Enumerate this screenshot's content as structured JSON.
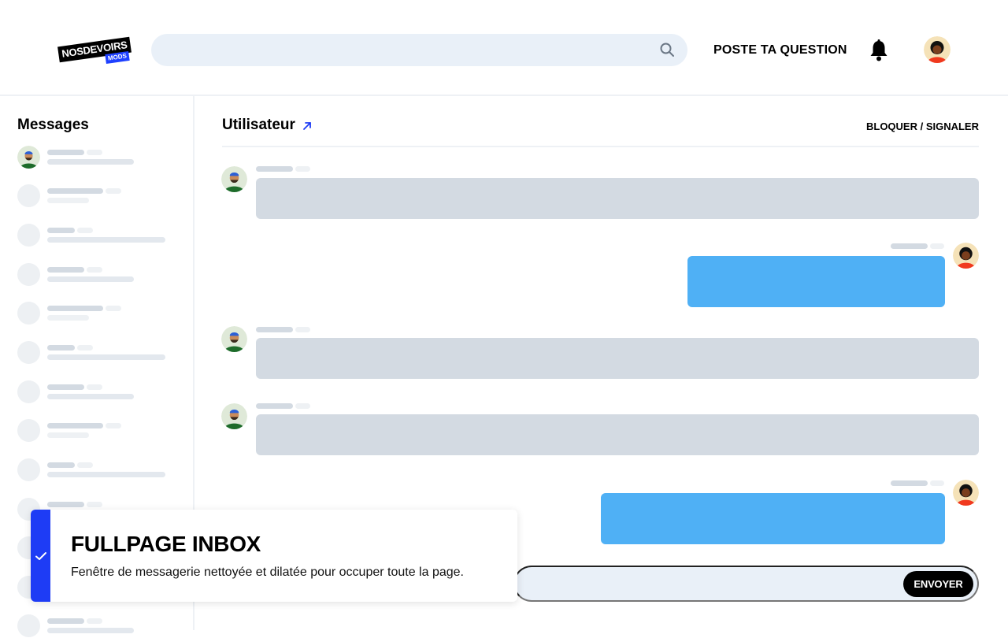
{
  "header": {
    "logo_text": "NOSDEVOIRS",
    "logo_sub": "MODS",
    "search": {
      "value": "",
      "placeholder": ""
    },
    "ask_label": "POSTE TA QUESTION"
  },
  "sidebar": {
    "title": "Messages"
  },
  "chat": {
    "title": "Utilisateur",
    "block_label": "BLOQUER / SIGNALER",
    "composer": {
      "value": "",
      "placeholder": ""
    },
    "send_label": "ENVOYER"
  },
  "toast": {
    "title": "FULLPAGE INBOX",
    "message": "Fenêtre de messagerie nettoyée et dilatée pour occuper toute la page."
  },
  "colors": {
    "accent_blue": "#1e3cf5",
    "outgoing_bubble": "#4fb0f5",
    "incoming_bubble": "#d3dae2",
    "search_bg": "#e9f0f8"
  },
  "icons": [
    "search-icon",
    "bell-icon",
    "external-link-icon",
    "check-icon"
  ]
}
